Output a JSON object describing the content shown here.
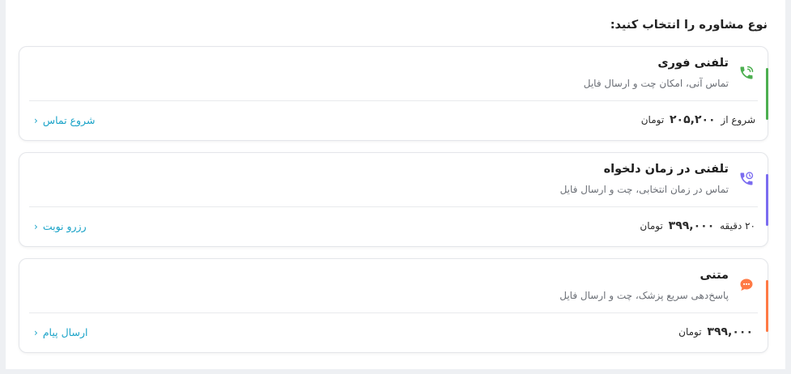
{
  "heading": "نوع مشاوره را انتخاب کنید:",
  "options": [
    {
      "title": "تلفنی فوری",
      "description": "تماس آنی، امکان چت و ارسال فایل",
      "price_prefix": "شروع از",
      "price_amount": "۲۰۵,۲۰۰",
      "price_unit": "تومان",
      "action_label": "شروع تماس",
      "accent": "#4caf50",
      "icon": "phone-icon"
    },
    {
      "title": "تلفنی در زمان دلخواه",
      "description": "تماس در زمان انتخابی، چت و ارسال فایل",
      "price_prefix": "۲۰ دقیقه",
      "price_amount": "۳۹۹,۰۰۰",
      "price_unit": "تومان",
      "action_label": "رزرو نوبت",
      "accent": "#7b6cf0",
      "icon": "scheduled-phone-icon"
    },
    {
      "title": "متنی",
      "description": "پاسخ‌دهی سریع پزشک، چت و ارسال فایل",
      "price_prefix": "",
      "price_amount": "۳۹۹,۰۰۰",
      "price_unit": "تومان",
      "action_label": "ارسال پیام",
      "accent": "#ff7a45",
      "icon": "chat-bubble-icon"
    }
  ]
}
